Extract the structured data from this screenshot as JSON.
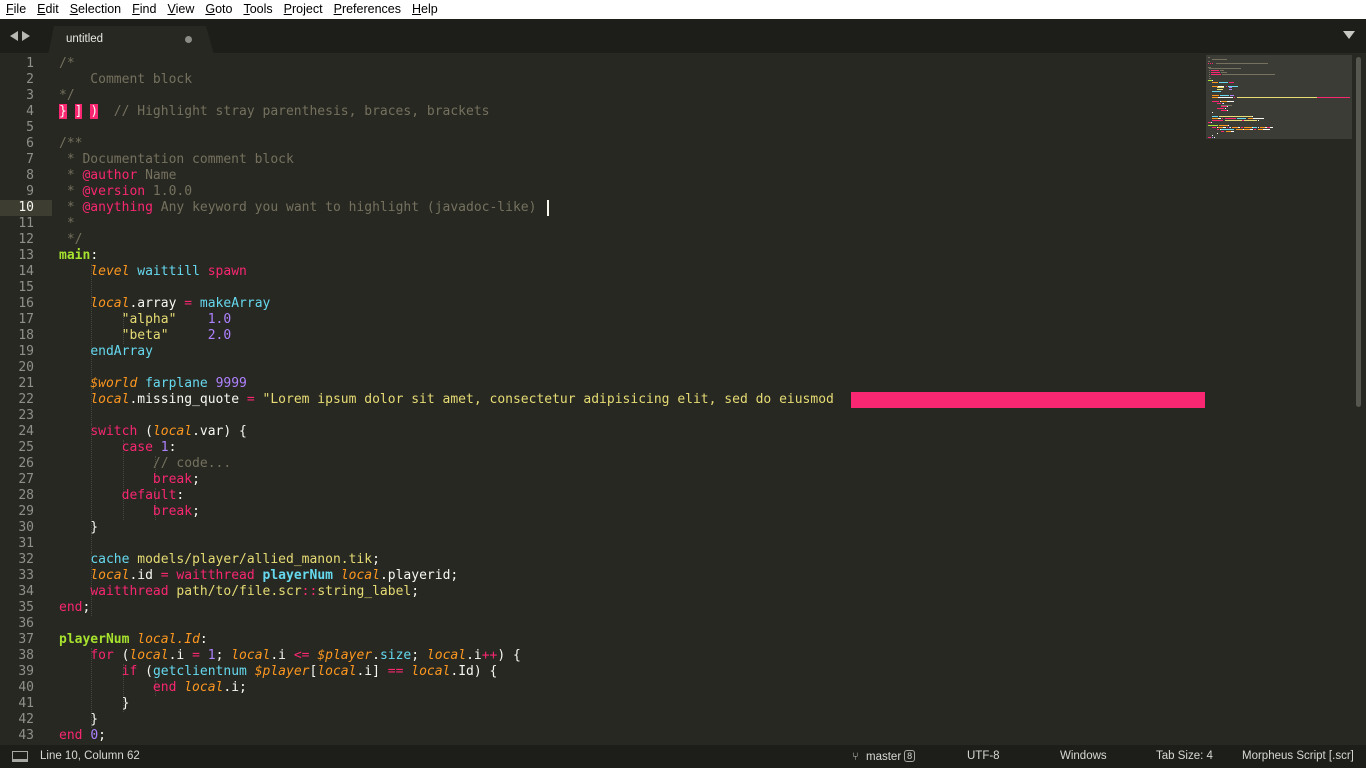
{
  "menu": [
    "File",
    "Edit",
    "Selection",
    "Find",
    "View",
    "Goto",
    "Tools",
    "Project",
    "Preferences",
    "Help"
  ],
  "tab": {
    "title": "untitled",
    "dirty": true
  },
  "colors": {
    "background": "#272822",
    "foreground": "#f8f8f2",
    "comment": "#75715e",
    "keyword": "#f92672",
    "function": "#66d9ef",
    "class": "#a6e22e",
    "string": "#e6db74",
    "number": "#ae81ff",
    "variable": "#fd971f",
    "invalid_bg": "#f92672"
  },
  "editor": {
    "current_line": 10,
    "line_numbers": [
      1,
      2,
      3,
      4,
      5,
      6,
      7,
      8,
      9,
      10,
      11,
      12,
      13,
      14,
      15,
      16,
      17,
      18,
      19,
      20,
      21,
      22,
      23,
      24,
      25,
      26,
      27,
      28,
      29,
      30,
      31,
      32,
      33,
      34,
      35,
      36,
      37,
      38,
      39,
      40,
      41,
      42,
      43
    ],
    "lines": [
      [
        [
          "c",
          "/*"
        ]
      ],
      [
        [
          "c",
          "    Comment block"
        ]
      ],
      [
        [
          "c",
          "*/"
        ]
      ],
      [
        [
          "inv",
          "}"
        ],
        [
          "t",
          " "
        ],
        [
          "inv",
          "]"
        ],
        [
          "t",
          " "
        ],
        [
          "inv",
          ")"
        ],
        [
          "t",
          "  "
        ],
        [
          "c",
          "// Highlight stray parenthesis, braces, brackets"
        ]
      ],
      [],
      [
        [
          "c",
          "/**"
        ]
      ],
      [
        [
          "c",
          " * Documentation comment block"
        ]
      ],
      [
        [
          "c",
          " * "
        ],
        [
          "k",
          "@author"
        ],
        [
          "c",
          " Name"
        ]
      ],
      [
        [
          "c",
          " * "
        ],
        [
          "k",
          "@version"
        ],
        [
          "c",
          " 1.0.0"
        ]
      ],
      [
        [
          "c",
          " * "
        ],
        [
          "k",
          "@anything"
        ],
        [
          "c",
          " Any keyword you want to highlight (javadoc-like)"
        ]
      ],
      [
        [
          "c",
          " *"
        ]
      ],
      [
        [
          "c",
          " */"
        ]
      ],
      [
        [
          "g",
          "main"
        ],
        [
          "t",
          ":"
        ]
      ],
      [
        [
          "t",
          "    "
        ],
        [
          "vi",
          "level"
        ],
        [
          "t",
          " "
        ],
        [
          "f",
          "waittill"
        ],
        [
          "t",
          " "
        ],
        [
          "k",
          "spawn"
        ]
      ],
      [],
      [
        [
          "t",
          "    "
        ],
        [
          "vi",
          "local"
        ],
        [
          "t",
          ".array "
        ],
        [
          "k",
          "="
        ],
        [
          "t",
          " "
        ],
        [
          "f",
          "makeArray"
        ]
      ],
      [
        [
          "t",
          "        "
        ],
        [
          "s",
          "\"alpha\""
        ],
        [
          "t",
          "    "
        ],
        [
          "n",
          "1.0"
        ]
      ],
      [
        [
          "t",
          "        "
        ],
        [
          "s",
          "\"beta\""
        ],
        [
          "t",
          "     "
        ],
        [
          "n",
          "2.0"
        ]
      ],
      [
        [
          "t",
          "    "
        ],
        [
          "f",
          "endArray"
        ]
      ],
      [],
      [
        [
          "t",
          "    "
        ],
        [
          "vi",
          "$world"
        ],
        [
          "t",
          " "
        ],
        [
          "f",
          "farplane"
        ],
        [
          "t",
          " "
        ],
        [
          "n",
          "9999"
        ]
      ],
      [
        [
          "t",
          "    "
        ],
        [
          "vi",
          "local"
        ],
        [
          "t",
          ".missing_quote "
        ],
        [
          "k",
          "="
        ],
        [
          "t",
          " "
        ],
        [
          "s",
          "\"Lorem ipsum dolor sit amet, consectetur adipisicing elit, sed do eiusmod"
        ]
      ],
      [],
      [
        [
          "t",
          "    "
        ],
        [
          "k",
          "switch"
        ],
        [
          "t",
          " ("
        ],
        [
          "vi",
          "local"
        ],
        [
          "t",
          ".var) {"
        ]
      ],
      [
        [
          "t",
          "        "
        ],
        [
          "k",
          "case"
        ],
        [
          "t",
          " "
        ],
        [
          "n",
          "1"
        ],
        [
          "t",
          ":"
        ]
      ],
      [
        [
          "t",
          "            "
        ],
        [
          "c",
          "// code..."
        ]
      ],
      [
        [
          "t",
          "            "
        ],
        [
          "k",
          "break"
        ],
        [
          "t",
          ";"
        ]
      ],
      [
        [
          "t",
          "        "
        ],
        [
          "k",
          "default"
        ],
        [
          "t",
          ":"
        ]
      ],
      [
        [
          "t",
          "            "
        ],
        [
          "k",
          "break"
        ],
        [
          "t",
          ";"
        ]
      ],
      [
        [
          "t",
          "    }"
        ]
      ],
      [],
      [
        [
          "t",
          "    "
        ],
        [
          "f",
          "cache"
        ],
        [
          "t",
          " "
        ],
        [
          "s",
          "models/player/allied_manon.tik"
        ],
        [
          "t",
          ";"
        ]
      ],
      [
        [
          "t",
          "    "
        ],
        [
          "vi",
          "local"
        ],
        [
          "t",
          ".id "
        ],
        [
          "k",
          "="
        ],
        [
          "t",
          " "
        ],
        [
          "k",
          "waitthread"
        ],
        [
          "t",
          " "
        ],
        [
          "fb",
          "playerNum"
        ],
        [
          "t",
          " "
        ],
        [
          "vi",
          "local"
        ],
        [
          "t",
          ".playerid;"
        ]
      ],
      [
        [
          "t",
          "    "
        ],
        [
          "k",
          "waitthread"
        ],
        [
          "t",
          " "
        ],
        [
          "s",
          "path/to/file.scr"
        ],
        [
          "k",
          "::"
        ],
        [
          "s",
          "string_label"
        ],
        [
          "t",
          ";"
        ]
      ],
      [
        [
          "k",
          "end"
        ],
        [
          "t",
          ";"
        ]
      ],
      [],
      [
        [
          "g",
          "playerNum"
        ],
        [
          "t",
          " "
        ],
        [
          "vi",
          "local.Id"
        ],
        [
          "t",
          ":"
        ]
      ],
      [
        [
          "t",
          "    "
        ],
        [
          "k",
          "for"
        ],
        [
          "t",
          " ("
        ],
        [
          "vi",
          "local"
        ],
        [
          "t",
          ".i "
        ],
        [
          "k",
          "="
        ],
        [
          "t",
          " "
        ],
        [
          "n",
          "1"
        ],
        [
          "t",
          "; "
        ],
        [
          "vi",
          "local"
        ],
        [
          "t",
          ".i "
        ],
        [
          "k",
          "<="
        ],
        [
          "t",
          " "
        ],
        [
          "vi",
          "$player"
        ],
        [
          "t",
          "."
        ],
        [
          "f",
          "size"
        ],
        [
          "t",
          "; "
        ],
        [
          "vi",
          "local"
        ],
        [
          "t",
          ".i"
        ],
        [
          "k",
          "++"
        ],
        [
          "t",
          ") {"
        ]
      ],
      [
        [
          "t",
          "        "
        ],
        [
          "k",
          "if"
        ],
        [
          "t",
          " ("
        ],
        [
          "f",
          "getclientnum"
        ],
        [
          "t",
          " "
        ],
        [
          "vi",
          "$player"
        ],
        [
          "t",
          "["
        ],
        [
          "vi",
          "local"
        ],
        [
          "t",
          ".i] "
        ],
        [
          "k",
          "=="
        ],
        [
          "t",
          " "
        ],
        [
          "vi",
          "local"
        ],
        [
          "t",
          ".Id) {"
        ]
      ],
      [
        [
          "t",
          "            "
        ],
        [
          "k",
          "end"
        ],
        [
          "t",
          " "
        ],
        [
          "vi",
          "local"
        ],
        [
          "t",
          ".i;"
        ]
      ],
      [
        [
          "t",
          "        }"
        ]
      ],
      [
        [
          "t",
          "    }"
        ]
      ],
      [
        [
          "k",
          "end"
        ],
        [
          "t",
          " "
        ],
        [
          "n",
          "0"
        ],
        [
          "t",
          ";"
        ]
      ]
    ]
  },
  "status": {
    "position": "Line 10, Column 62",
    "branch": "master",
    "changes": "8",
    "encoding": "UTF-8",
    "line_endings": "Windows",
    "tab_size": "Tab Size: 4",
    "syntax": "Morpheus Script [.scr]"
  }
}
